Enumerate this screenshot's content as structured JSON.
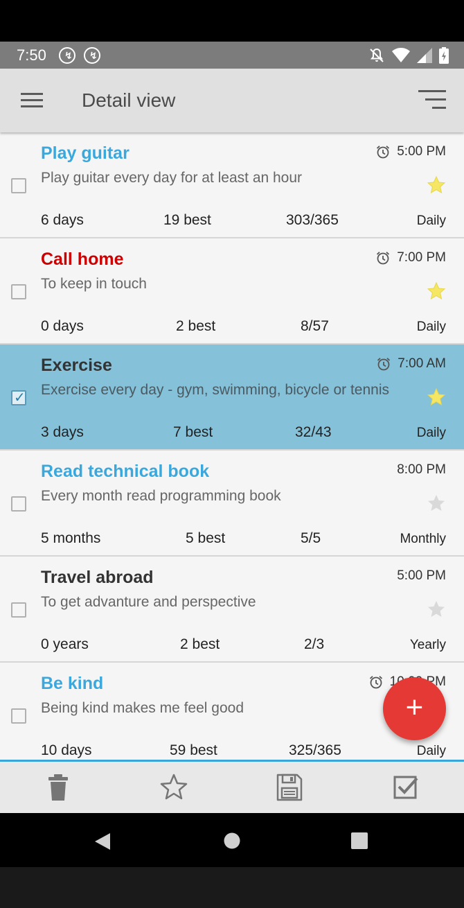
{
  "status_bar": {
    "time": "7:50",
    "left_icons": [
      "notification-icon",
      "notification-icon"
    ],
    "right_icons": [
      "mute-icon",
      "wifi-icon",
      "signal-icon",
      "battery-icon"
    ]
  },
  "app_bar": {
    "title": "Detail view",
    "menu_icon": "hamburger-menu-icon",
    "sort_icon": "sort-icon"
  },
  "habits": [
    {
      "title": "Play guitar",
      "title_color": "#3aa8dc",
      "description": "Play guitar every day for at least an hour",
      "time": "5:00 PM",
      "has_alarm": true,
      "starred": true,
      "checked": false,
      "streak": "6 days",
      "best": "19 best",
      "progress": "303/365",
      "frequency": "Daily"
    },
    {
      "title": "Call home",
      "title_color": "#cc0000",
      "description": "To keep in touch",
      "time": "7:00 PM",
      "has_alarm": true,
      "starred": true,
      "checked": false,
      "streak": "0 days",
      "best": "2 best",
      "progress": "8/57",
      "frequency": "Daily"
    },
    {
      "title": "Exercise",
      "title_color": "#333333",
      "description": "Exercise every day - gym, swimming, bicycle or tennis",
      "time": "7:00 AM",
      "has_alarm": true,
      "starred": true,
      "checked": true,
      "selected": true,
      "streak": "3 days",
      "best": "7 best",
      "progress": "32/43",
      "frequency": "Daily"
    },
    {
      "title": "Read technical book",
      "title_color": "#3aa8dc",
      "description": "Every month read programming book",
      "time": "8:00 PM",
      "has_alarm": false,
      "starred": false,
      "checked": false,
      "streak": "5 months",
      "best": "5 best",
      "progress": "5/5",
      "frequency": "Monthly"
    },
    {
      "title": "Travel abroad",
      "title_color": "#333333",
      "description": "To get advanture and perspective",
      "time": "5:00 PM",
      "has_alarm": false,
      "starred": false,
      "checked": false,
      "streak": "0 years",
      "best": "2 best",
      "progress": "2/3",
      "frequency": "Yearly"
    },
    {
      "title": "Be kind",
      "title_color": "#3aa8dc",
      "description": "Being kind makes me feel good",
      "time": "10:00 PM",
      "has_alarm": true,
      "starred": false,
      "checked": false,
      "streak": "10 days",
      "best": "59 best",
      "progress": "325/365",
      "frequency": "Daily"
    }
  ],
  "fab": {
    "label": "+",
    "icon": "add-icon",
    "color": "#e53935"
  },
  "bottom_toolbar": {
    "icons": [
      "trash-icon",
      "star-outline-icon",
      "save-icon",
      "checkbox-icon"
    ]
  },
  "nav_bar": {
    "icons": [
      "back-icon",
      "home-icon",
      "recents-icon"
    ]
  },
  "colors": {
    "accent_blue": "#3aa8dc",
    "selected_row": "#85c1d9",
    "star_yellow": "#f5e663"
  }
}
